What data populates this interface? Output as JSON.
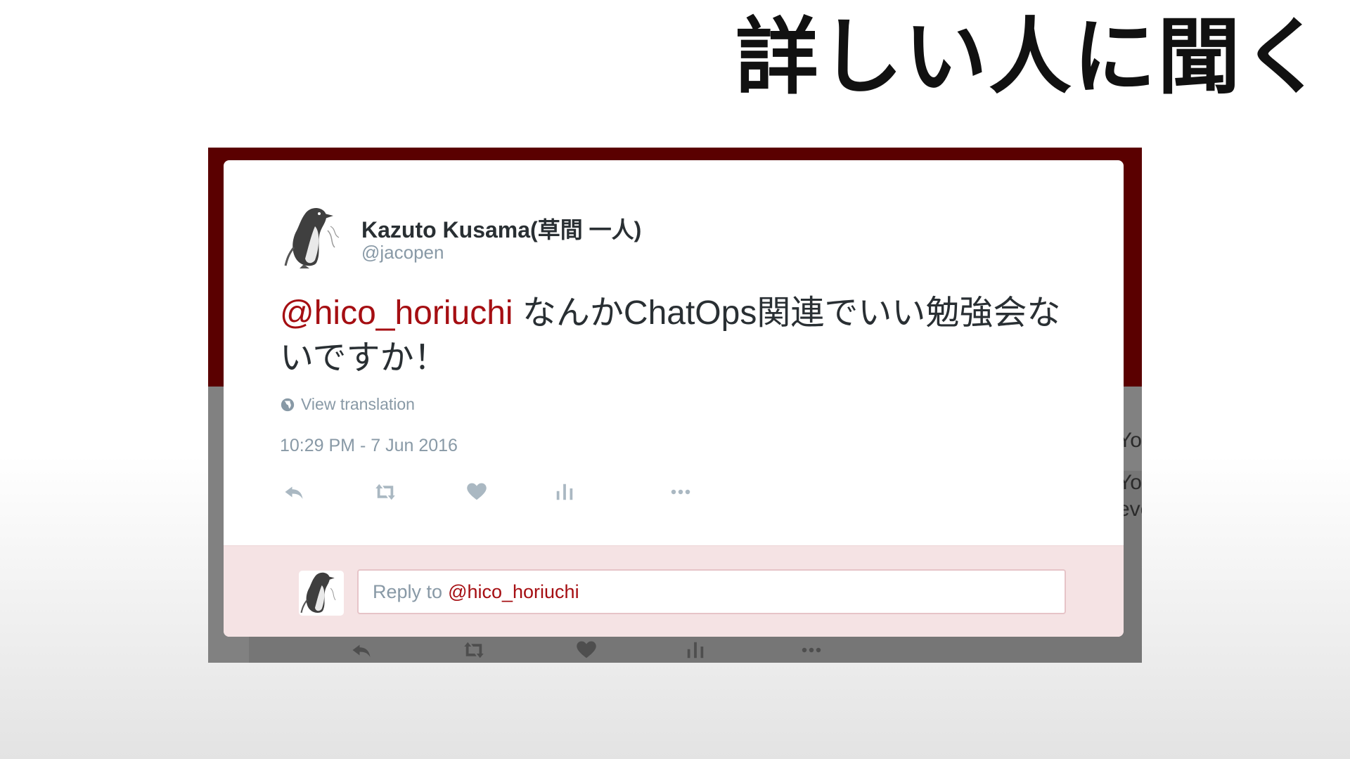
{
  "slide": {
    "title": "詳しい人に聞く"
  },
  "tweet": {
    "author_name": "Kazuto Kusama(草間 一人)",
    "author_handle": "@jacopen",
    "mention": "@hico_horiuchi",
    "text": " なんかChatOps関連でいい勉強会ないですか！",
    "view_translation_label": "View translation",
    "timestamp": "10:29 PM - 7 Jun 2016",
    "actions": [
      "reply-icon",
      "retweet-icon",
      "heart-icon",
      "analytics-icon",
      "more-icon"
    ]
  },
  "reply": {
    "prompt": "Reply to",
    "mention": "@hico_horiuchi"
  },
  "background": {
    "side_text_1": "You",
    "side_text_2": "You",
    "side_text_3": "eve"
  },
  "colors": {
    "header_band": "#5a0000",
    "mention": "#a50e12",
    "reply_bar": "#f5e3e4",
    "muted_text": "#8899a6"
  }
}
